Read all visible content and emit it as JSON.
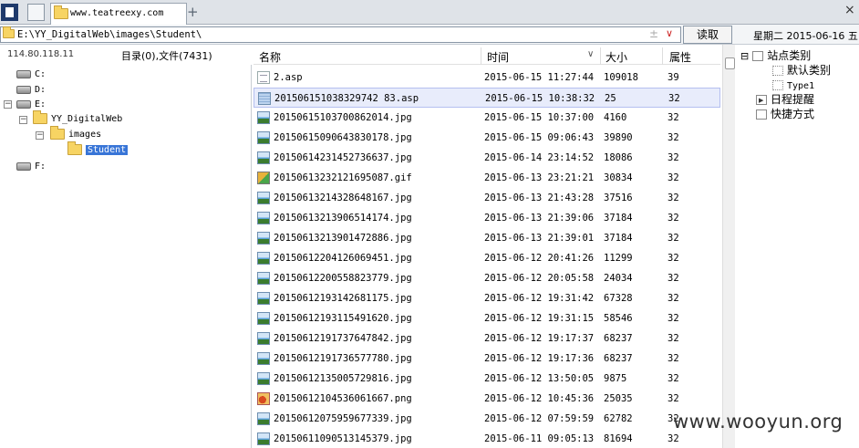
{
  "tab": {
    "title": "www.teatreexy.com"
  },
  "pathbar": {
    "path": "E:\\YY_DigitalWeb\\images\\Student\\",
    "read_button": "读取",
    "date": "星期二 2015-06-16 五"
  },
  "info": {
    "ip": "114.80.118.11",
    "summary": "目录(0),文件(7431)"
  },
  "tree": {
    "items": [
      {
        "label": "C:",
        "type": "drive"
      },
      {
        "label": "D:",
        "type": "drive"
      },
      {
        "label": "E:",
        "type": "drive"
      },
      {
        "label": "YY_DigitalWeb",
        "type": "folder"
      },
      {
        "label": "images",
        "type": "folder"
      },
      {
        "label": "Student",
        "type": "folder",
        "selected": true
      },
      {
        "label": "F:",
        "type": "drive"
      }
    ]
  },
  "columns": {
    "name": "名称",
    "time": "时间",
    "size": "大小",
    "attr": "属性"
  },
  "files": [
    {
      "name": "2.asp",
      "time": "2015-06-15 11:27:44",
      "size": "109018",
      "attr": "39",
      "icon": "doc"
    },
    {
      "name": "201506151038329742 83.asp",
      "time": "2015-06-15 10:38:32",
      "size": "25",
      "attr": "32",
      "icon": "script"
    },
    {
      "name": "20150615103700862014.jpg",
      "time": "2015-06-15 10:37:00",
      "size": "4160",
      "attr": "32",
      "icon": "img"
    },
    {
      "name": "20150615090643830178.jpg",
      "time": "2015-06-15 09:06:43",
      "size": "39890",
      "attr": "32",
      "icon": "img"
    },
    {
      "name": "20150614231452736637.jpg",
      "time": "2015-06-14 23:14:52",
      "size": "18086",
      "attr": "32",
      "icon": "img"
    },
    {
      "name": "20150613232121695087.gif",
      "time": "2015-06-13 23:21:21",
      "size": "30834",
      "attr": "32",
      "icon": "gif"
    },
    {
      "name": "20150613214328648167.jpg",
      "time": "2015-06-13 21:43:28",
      "size": "37516",
      "attr": "32",
      "icon": "img"
    },
    {
      "name": "20150613213906514174.jpg",
      "time": "2015-06-13 21:39:06",
      "size": "37184",
      "attr": "32",
      "icon": "img"
    },
    {
      "name": "20150613213901472886.jpg",
      "time": "2015-06-13 21:39:01",
      "size": "37184",
      "attr": "32",
      "icon": "img"
    },
    {
      "name": "20150612204126069451.jpg",
      "time": "2015-06-12 20:41:26",
      "size": "11299",
      "attr": "32",
      "icon": "img"
    },
    {
      "name": "20150612200558823779.jpg",
      "time": "2015-06-12 20:05:58",
      "size": "24034",
      "attr": "32",
      "icon": "img"
    },
    {
      "name": "20150612193142681175.jpg",
      "time": "2015-06-12 19:31:42",
      "size": "67328",
      "attr": "32",
      "icon": "img"
    },
    {
      "name": "20150612193115491620.jpg",
      "time": "2015-06-12 19:31:15",
      "size": "58546",
      "attr": "32",
      "icon": "img"
    },
    {
      "name": "20150612191737647842.jpg",
      "time": "2015-06-12 19:17:37",
      "size": "68237",
      "attr": "32",
      "icon": "img"
    },
    {
      "name": "20150612191736577780.jpg",
      "time": "2015-06-12 19:17:36",
      "size": "68237",
      "attr": "32",
      "icon": "img"
    },
    {
      "name": "20150612135005729816.jpg",
      "time": "2015-06-12 13:50:05",
      "size": "9875",
      "attr": "32",
      "icon": "img"
    },
    {
      "name": "20150612104536061667.png",
      "time": "2015-06-12 10:45:36",
      "size": "25035",
      "attr": "32",
      "icon": "png"
    },
    {
      "name": "20150612075959677339.jpg",
      "time": "2015-06-12 07:59:59",
      "size": "62782",
      "attr": "32",
      "icon": "img"
    },
    {
      "name": "20150611090513145379.jpg",
      "time": "2015-06-11 09:05:13",
      "size": "81694",
      "attr": "32",
      "icon": "img"
    }
  ],
  "rightpanel": {
    "items": [
      {
        "label": "站点类别",
        "level": 0,
        "expander": "⊟"
      },
      {
        "label": "默认类别",
        "level": 1
      },
      {
        "label": "Type1",
        "level": 1
      },
      {
        "label": "日程提醒",
        "level": 0
      },
      {
        "label": "快捷方式",
        "level": 0
      }
    ]
  },
  "watermark": "www.wooyun.org"
}
